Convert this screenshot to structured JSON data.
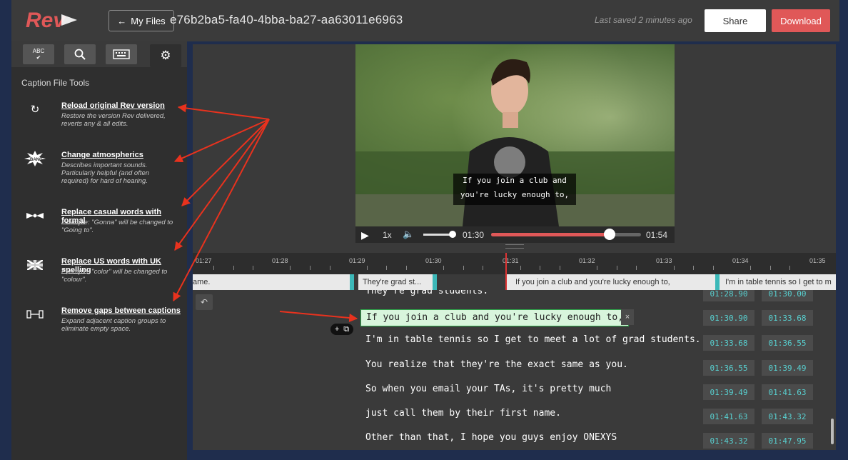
{
  "app": {
    "logo_text": "Rev"
  },
  "topbar": {
    "my_files_label": "My Files",
    "file_title": "e76b2ba5-fa40-4bba-ba27-aa63011e6963",
    "saved_text": "Last saved 2 minutes ago",
    "share_label": "Share",
    "download_label": "Download"
  },
  "sidebar": {
    "tabs": [
      {
        "icon": "spellcheck-icon",
        "label": "ABC"
      },
      {
        "icon": "search-icon"
      },
      {
        "icon": "keyboard-icon"
      },
      {
        "icon": "gear-icon"
      }
    ],
    "title": "Caption File Tools",
    "tools": [
      {
        "icon": "reload-icon",
        "label": "Reload original Rev version",
        "description": "Restore the version Rev delivered, reverts any & all edits."
      },
      {
        "icon": "atmospherics-icon",
        "label": "Change atmospherics",
        "description": "Describes important sounds. Particularly helpful (and often required) for hard of hearing."
      },
      {
        "icon": "formal-words-icon",
        "label": "Replace casual words with formal",
        "description": "Example: \"Gonna\" will be changed to \"Going to\"."
      },
      {
        "icon": "uk-flag-icon",
        "label": "Replace US words with UK spelling",
        "description": "Example: \"color\" will be changed to \"colour\"."
      },
      {
        "icon": "remove-gaps-icon",
        "label": "Remove gaps between captions",
        "description": "Expand adjacent caption groups to eliminate empty space."
      }
    ]
  },
  "video": {
    "caption_line1": "If you join a club and",
    "caption_line2": "you're lucky enough to,",
    "speed": "1x",
    "current_time": "01:30",
    "duration": "01:54",
    "progress": 0.79
  },
  "timeline": {
    "ticks": [
      "01:27",
      "01:28",
      "01:29",
      "01:30",
      "01:31",
      "01:32",
      "01:33",
      "01:34",
      "01:35"
    ],
    "segments": [
      "ame.",
      "They're grad st...",
      "If you join a club and you're lucky enough to,",
      "I'm in table tennis so I get to m"
    ]
  },
  "editor": {
    "lines": [
      {
        "text": "They're grad students.",
        "start": "01:28.90",
        "end": "01:30.00"
      },
      {
        "text": "If you join a club and you're lucky enough to,",
        "start": "01:30.90",
        "end": "01:33.68"
      },
      {
        "text": "I'm in table tennis so I get to meet a lot of grad students.",
        "start": "01:33.68",
        "end": "01:36.55"
      },
      {
        "text": "You realize that they're the exact same as you.",
        "start": "01:36.55",
        "end": "01:39.49"
      },
      {
        "text": "So when you email your TAs, it's pretty much",
        "start": "01:39.49",
        "end": "01:41.63"
      },
      {
        "text": "just call them by their first name.",
        "start": "01:41.63",
        "end": "01:43.32"
      },
      {
        "text": "Other than that, I hope you guys enjoy ONEXYS",
        "start": "01:43.32",
        "end": "01:47.95"
      }
    ],
    "close_label": "×",
    "plus_label": "+"
  },
  "colors": {
    "accent": "#3cb8b8",
    "download": "#e05858",
    "annotation": "#e8321e"
  }
}
